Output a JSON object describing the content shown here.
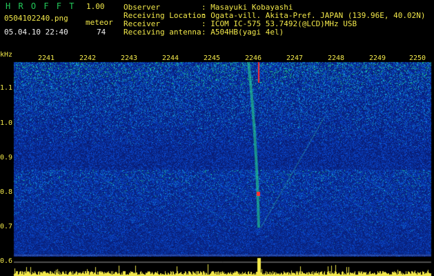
{
  "header": {
    "app_name": "H R O F F T",
    "version": "1.00",
    "filename": "0504102240.png",
    "label_meteor": "meteor",
    "date_time": "05.04.10 22:40",
    "meteor_count": "74"
  },
  "info": {
    "observer_label": "Observer",
    "observer_value": ": Masayuki Kobayashi",
    "location_label": "Receiving Location",
    "location_value": ": Ogata-vill. Akita-Pref. JAPAN (139.96E, 40.02N)",
    "receiver_label": "Receiver",
    "receiver_value": ": ICOM IC-575 53.7492(@LCD)MHz USB",
    "antenna_label": "Receiving antenna",
    "antenna_value": ": A504HB(yagi 4el)"
  },
  "axis": {
    "y_unit": "kHz",
    "y_ticks": [
      "1.1",
      "1.0",
      "0.9",
      "0.8",
      "0.7",
      "0.6"
    ],
    "x_ticks": [
      "2241",
      "2242",
      "2243",
      "2244",
      "2245",
      "2246",
      "2247",
      "2248",
      "2249",
      "2250"
    ]
  },
  "colors": {
    "text_green": "#22c95a",
    "text_yellow": "#f2e84a",
    "background": "#000000",
    "spectrum_low": "#0c1a8a",
    "spectrum_high": "#ff2020"
  }
}
